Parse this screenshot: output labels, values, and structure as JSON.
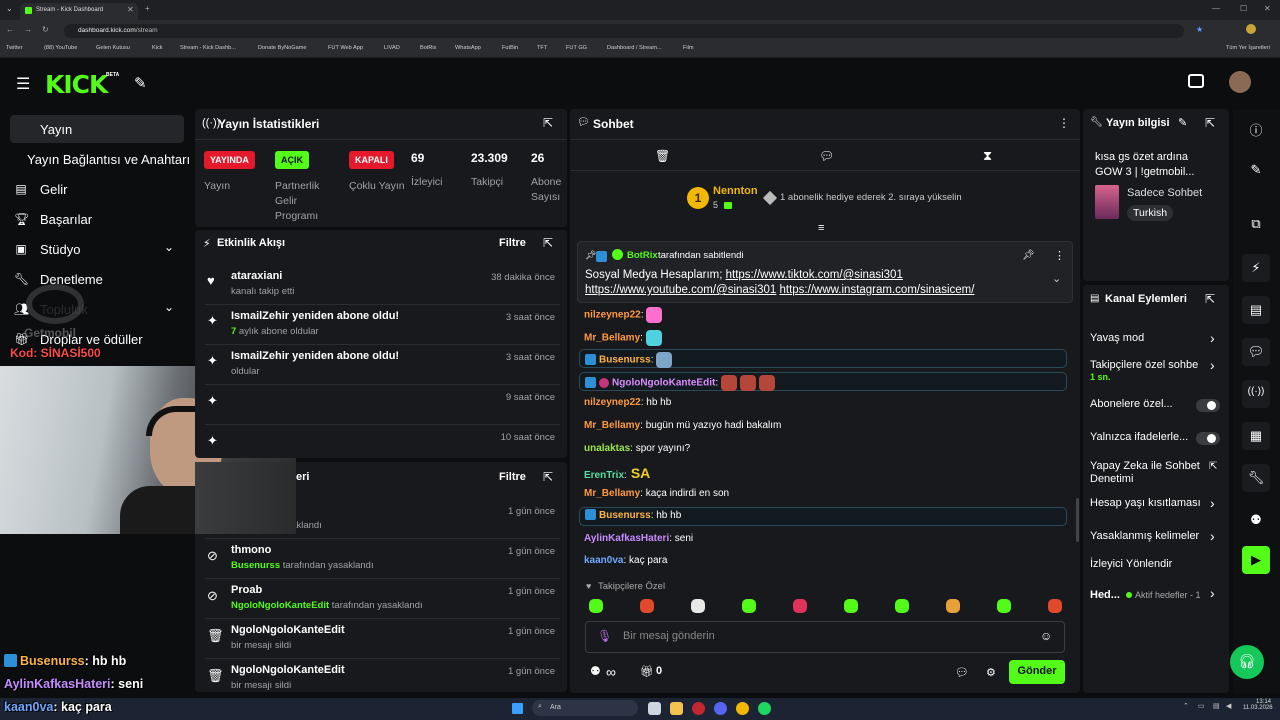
{
  "browser": {
    "tab_title": "Stream - Kick Dashboard",
    "url_host": "dashboard.kick.com",
    "url_path": "/stream",
    "bookmarks": [
      "Twitter",
      "(88) YouTube",
      "Gelen Kutusu",
      "Kick",
      "Stream - Kick Dashb...",
      "Donate ByNoGame",
      "FUT Web App",
      "LIVAD",
      "BotRix",
      "WhatsApp",
      "FutBin",
      "TFT",
      "FUT GG",
      "Dashboard / Stream...",
      "Film"
    ],
    "all_bookmarks": "Tüm Yer İşaretleri"
  },
  "header": {
    "logo": "KICK",
    "beta": "BETA"
  },
  "sidebar": {
    "items": [
      {
        "label": "Yayın"
      },
      {
        "label": "Yayın Bağlantısı ve Anahtarı"
      },
      {
        "label": "Gelir"
      },
      {
        "label": "Başarılar"
      },
      {
        "label": "Stüdyo"
      },
      {
        "label": "Denetleme"
      },
      {
        "label": "Topluluk"
      },
      {
        "label": "Droplar ve ödüller"
      }
    ]
  },
  "overlay": {
    "code": "Kod: SİNASİ500",
    "getmobil": "Getmobil",
    "chat": [
      {
        "user": "Busenurss",
        "text": ": hb hb",
        "color": "#ffb347"
      },
      {
        "user": "AylinKafkasHateri",
        "text": ": seni",
        "color": "#c58cff"
      },
      {
        "user": "kaan0va",
        "text": ": kaç para",
        "color": "#6fa8ff"
      }
    ]
  },
  "stats": {
    "title": "Yayın İstatistikleri",
    "badges": [
      {
        "badge": "YAYINDA",
        "label": "Yayın",
        "color": "#e5192c"
      },
      {
        "badge": "AÇIK",
        "label": "Partnerlik Gelir Programı",
        "color": "#53fc18"
      },
      {
        "badge": "KAPALI",
        "label": "Çoklu Yayın",
        "color": "#e5192c"
      }
    ],
    "numbers": [
      {
        "value": "69",
        "label": "İzleyici"
      },
      {
        "value": "23.309",
        "label": "Takipçi"
      },
      {
        "value": "26",
        "label": "Abone Sayısı"
      }
    ]
  },
  "activity": {
    "title": "Etkinlik Akışı",
    "filter": "Filtre",
    "events": [
      {
        "title": "ataraxiani",
        "sub": "kanalı takip etti",
        "time": "38 dakika önce",
        "sub_prefix": ""
      },
      {
        "title": "IsmailZehir yeniden abone oldu!",
        "sub_prefix": "7",
        "sub": " aylık abone oldular",
        "time": "3 saat önce"
      },
      {
        "title": "IsmailZehir yeniden abone oldu!",
        "sub_prefix": "",
        "sub": "oldular",
        "time": "3 saat önce"
      },
      {
        "title": "",
        "sub_prefix": "",
        "sub": "",
        "time": "9 saat önce"
      },
      {
        "title": "",
        "sub_prefix": "",
        "sub": "",
        "time": "10 saat önce"
      }
    ]
  },
  "moderation": {
    "title": "eri",
    "filter": "Filtre",
    "events": [
      {
        "title": "",
        "user": "",
        "sub": "tarafından yasaklandı",
        "time": "1 gün önce"
      },
      {
        "title": "thmono",
        "user": "Busenurss",
        "sub": " tarafından yasaklandı",
        "time": "1 gün önce"
      },
      {
        "title": "Proab",
        "user": "NgoloNgoloKanteEdit",
        "sub": " tarafından yasaklandı",
        "time": "1 gün önce"
      },
      {
        "title": "NgoloNgoloKanteEdit",
        "user": "",
        "sub": "bir mesajı sildi",
        "time": "1 gün önce"
      },
      {
        "title": "NgoloNgoloKanteEdit",
        "user": "",
        "sub": "bir mesajı sildi",
        "time": "1 gün önce"
      }
    ]
  },
  "chat": {
    "title": "Sohbet",
    "top_gifter": {
      "name": "Nennton",
      "count": "5",
      "rank": "1",
      "promo": "1 abonelik hediye ederek 2. sıraya yükselin"
    },
    "pinned": {
      "by": "BotRix",
      "by_suffix": " tarafından sabitlendi",
      "text": "Sosyal Medya Hesaplarım; ",
      "link1": "https://www.tiktok.com/@sinasi301",
      "link2": "https://www.youtube.com/@sinasi301",
      "link3": "https://www.instagram.com/sinasicem/"
    },
    "messages": [
      {
        "user": "nilzeynep22",
        "text": ":",
        "color": "#ff9a3c"
      },
      {
        "user": "Mr_Bellamy",
        "text": ":",
        "color": "#ff9a3c"
      },
      {
        "user": "Busenurss",
        "text": ":",
        "color": "#ffb347"
      },
      {
        "user": "NgoloNgoloKanteEdit",
        "text": ":",
        "color": "#d98cff"
      },
      {
        "user": "nilzeynep22",
        "text": ": hb hb",
        "color": "#ff9a3c"
      },
      {
        "user": "Mr_Bellamy",
        "text": ": bugün mü yazıyo hadi bakalım",
        "color": "#ff9a3c"
      },
      {
        "user": "unalaktas",
        "text": ": spor yayını?",
        "color": "#9be84b"
      },
      {
        "user": "ErenTrix",
        "text": ":",
        "color": "#53e0a0"
      },
      {
        "user": "Mr_Bellamy",
        "text": ": kaça indirdi en son",
        "color": "#ff9a3c"
      },
      {
        "user": "Busenurss",
        "text": ": hb hb",
        "color": "#ffb347"
      },
      {
        "user": "AylinKafkasHateri",
        "text": ": seni",
        "color": "#c58cff"
      },
      {
        "user": "kaan0va",
        "text": ": kaç para",
        "color": "#6fa8ff"
      }
    ],
    "emote_text_sa": "SA",
    "emote_section": "Takipçilere Özel",
    "input_placeholder": "Bir mesaj gönderin",
    "points": "∞",
    "gift_count": "0",
    "send": "Gönder"
  },
  "stream_info": {
    "title": "Yayın bilgisi",
    "stream_title": "kısa gs özet ardına GOW 3 | !getmobil...",
    "category": "Sadece Sohbet",
    "language": "Turkish"
  },
  "channel_actions": {
    "title": "Kanal Eylemleri",
    "items": [
      {
        "label": "Yavaş mod",
        "sub": ""
      },
      {
        "label": "Takipçilere özel sohbe",
        "sub": "1 sn."
      },
      {
        "label": "Abonelere özel...",
        "sub": ""
      },
      {
        "label": "Yalnızca ifadelerle...",
        "sub": ""
      },
      {
        "label": "Yapay Zeka ile Sohbet Denetimi",
        "sub": ""
      },
      {
        "label": "Hesap yaşı kısıtlaması",
        "sub": ""
      },
      {
        "label": "Yasaklanmış kelimeler",
        "sub": ""
      },
      {
        "label": "İzleyici Yönlendir",
        "sub": ""
      },
      {
        "label": "Hed...",
        "sub": "Aktif hedefler - 1"
      }
    ]
  },
  "taskbar": {
    "search": "Ara",
    "time": "13:14",
    "date": "11.03.2026"
  }
}
